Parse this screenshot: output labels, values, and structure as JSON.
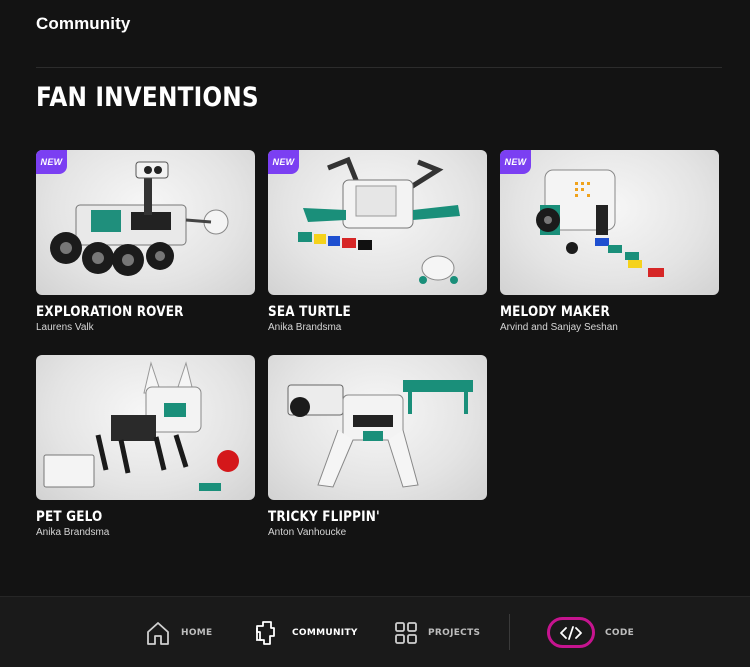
{
  "header": {
    "title": "Community"
  },
  "section": {
    "title": "FAN INVENTIONS"
  },
  "cards": [
    {
      "badge": "NEW",
      "title": "EXPLORATION ROVER",
      "author": "Laurens Valk"
    },
    {
      "badge": "NEW",
      "title": "SEA TURTLE",
      "author": "Anika Brandsma"
    },
    {
      "badge": "NEW",
      "title": "MELODY MAKER",
      "author": "Arvind and Sanjay Seshan"
    },
    {
      "title": "PET GELO",
      "author": "Anika Brandsma"
    },
    {
      "title": "TRICKY FLIPPIN'",
      "author": "Anton Vanhoucke"
    }
  ],
  "nav": {
    "home": {
      "label": "HOME",
      "icon": "home-icon"
    },
    "community": {
      "label": "COMMUNITY",
      "icon": "community-icon"
    },
    "projects": {
      "label": "PROJECTS",
      "icon": "projects-icon"
    },
    "code": {
      "label": "CODE",
      "icon": "code-icon"
    }
  },
  "colors": {
    "background": "#131313",
    "badge": "#7b3ff2",
    "code_highlight": "#c6148f",
    "lego_teal": "#1a8f7a"
  }
}
